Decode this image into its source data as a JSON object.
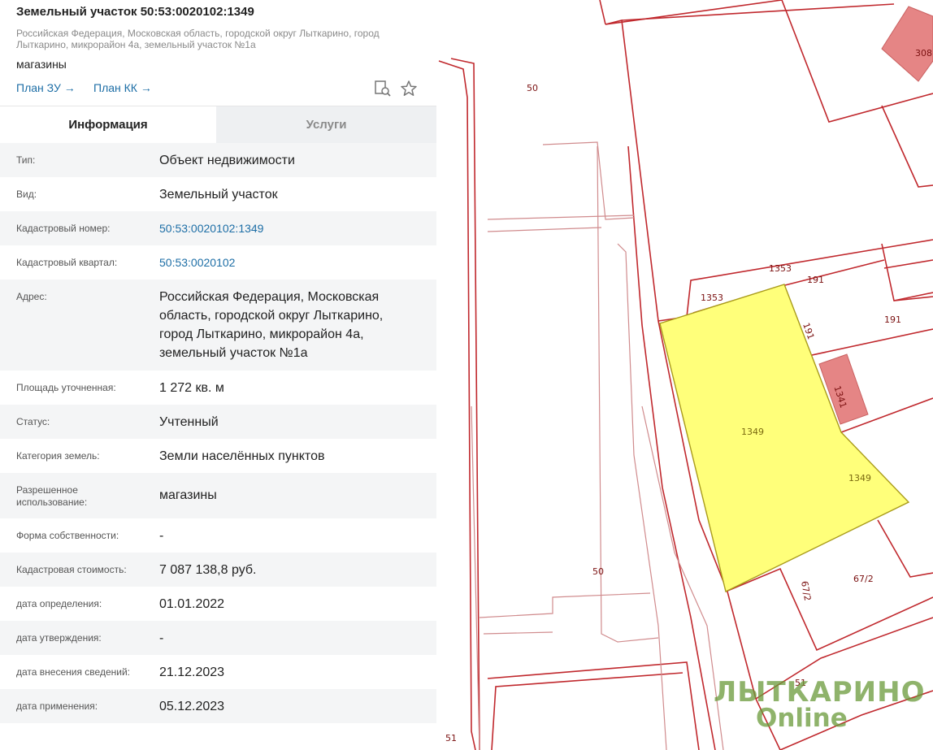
{
  "header": {
    "title": "Земельный участок 50:53:0020102:1349",
    "address": "Российская Федерация, Московская область, городской округ Лыткарино, город Лыткарино, микрорайон 4а, земельный участок №1а",
    "usage": "магазины",
    "plan_zu": "План ЗУ →",
    "plan_kk": "План КК →",
    "icons": [
      "search-document-icon",
      "star-icon"
    ]
  },
  "tabs": {
    "info": "Информация",
    "services": "Услуги"
  },
  "rows": [
    {
      "label": "Тип:",
      "value": "Объект недвижимости"
    },
    {
      "label": "Вид:",
      "value": "Земельный участок"
    },
    {
      "label": "Кадастровый номер:",
      "value": "50:53:0020102:1349"
    },
    {
      "label": "Кадастровый квартал:",
      "value": "50:53:0020102"
    },
    {
      "label": "Адрес:",
      "value": "Российская Федерация, Московская область, городской округ Лыткарино, город Лыткарино, микрорайон 4а, земельный участок №1а"
    },
    {
      "label": "Площадь уточненная:",
      "value": "1 272 кв. м"
    },
    {
      "label": "Статус:",
      "value": "Учтенный"
    },
    {
      "label": "Категория земель:",
      "value": "Земли населённых пунктов"
    },
    {
      "label": "Разрешенное использование:",
      "value": "магазины"
    },
    {
      "label": "Форма собственности:",
      "value": "-"
    },
    {
      "label": "Кадастровая стоимость:",
      "value": "7 087 138,8 руб."
    },
    {
      "label": "дата определения:",
      "value": "01.01.2022"
    },
    {
      "label": "дата утверждения:",
      "value": "-"
    },
    {
      "label": "дата внесения сведений:",
      "value": "21.12.2023"
    },
    {
      "label": "дата применения:",
      "value": "05.12.2023"
    }
  ],
  "map": {
    "labels": {
      "l50a": "50",
      "l50b": "50",
      "l1353a": "1353",
      "l1353b": "1353",
      "l191a": "191",
      "l191b": "191",
      "l191c": "191",
      "l1349a": "1349",
      "l1349b": "1349",
      "l1341": "1341",
      "l672a": "67/2",
      "l672b": "67/2",
      "l51a": "51",
      "l51b": "51",
      "l308": "308"
    },
    "colors": {
      "boundary": "#c0282d",
      "selected_fill": "#ffff7a",
      "building": "#e58585"
    },
    "watermark_line1": "ЛЫТКАРИНО",
    "watermark_line2": "Online"
  }
}
